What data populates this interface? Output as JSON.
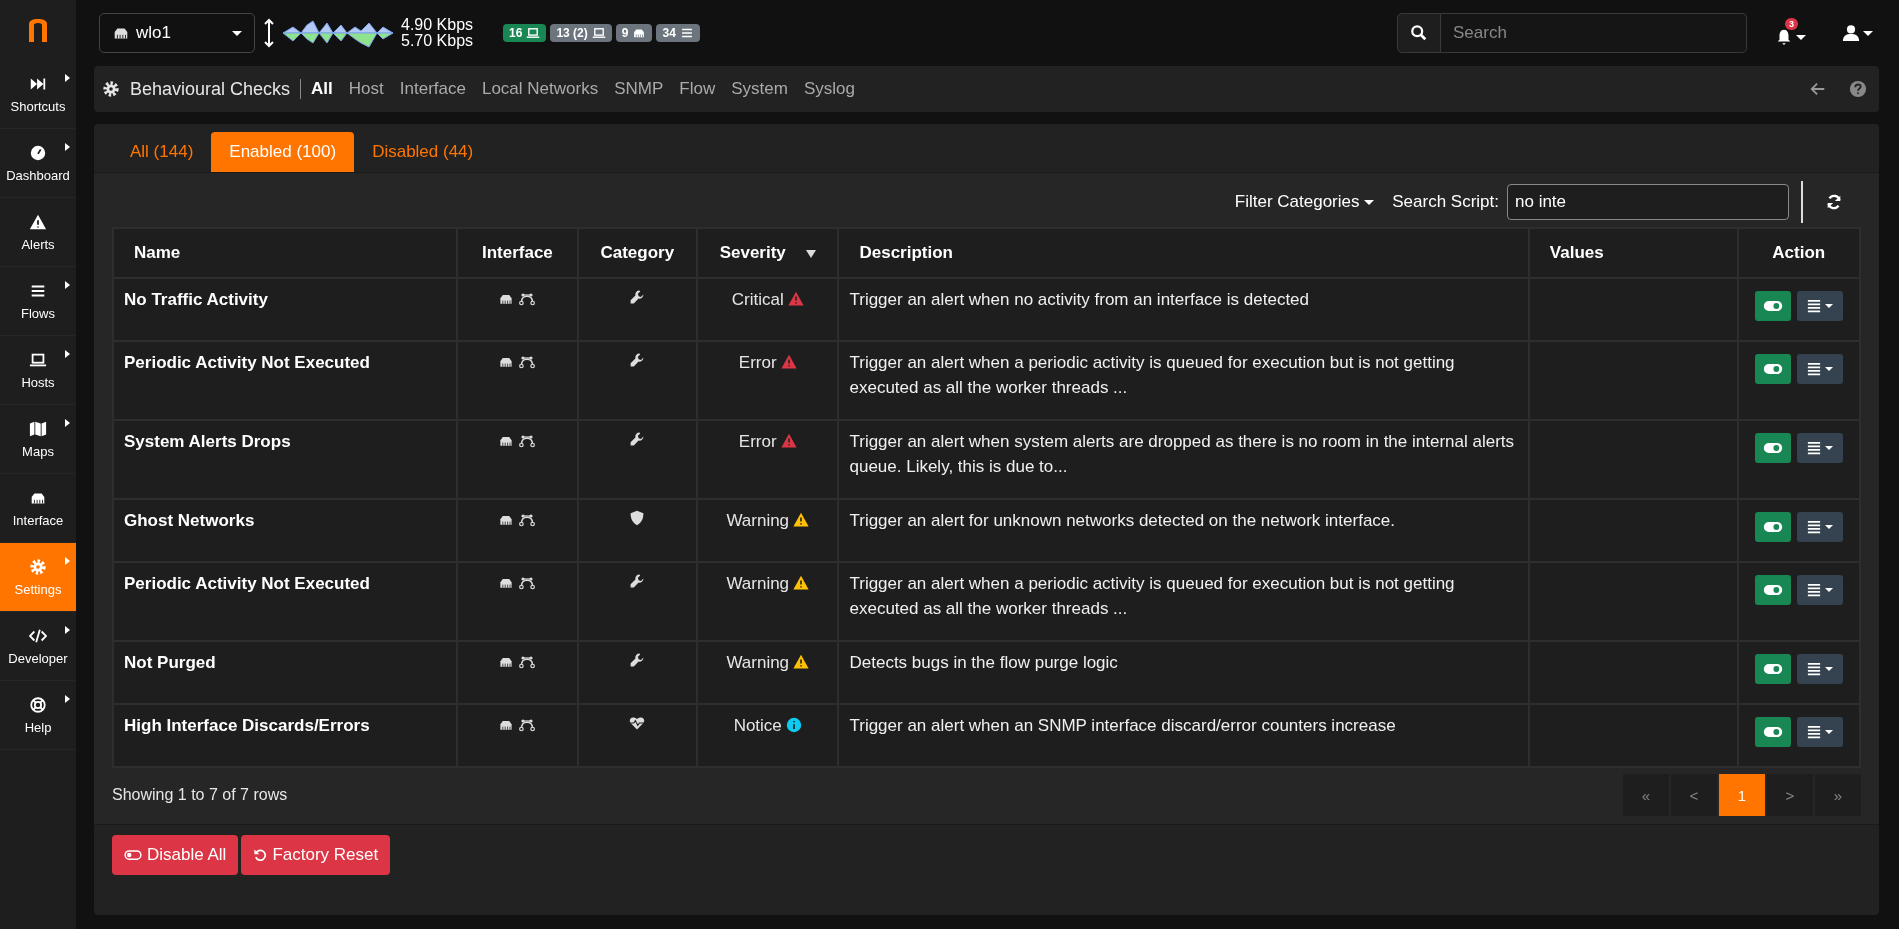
{
  "topbar": {
    "interface": "wlo1",
    "traffic_up": "4.90 Kbps",
    "traffic_down": "5.70 Kbps",
    "badges": [
      {
        "text": "16",
        "kind": "laptop",
        "color": "#198754"
      },
      {
        "text": "13 (2)",
        "kind": "laptop",
        "color": "#6c757d"
      },
      {
        "text": "9",
        "kind": "ethernet",
        "color": "#6c757d"
      },
      {
        "text": "34",
        "kind": "list",
        "color": "#6c757d"
      }
    ],
    "search": {
      "placeholder": "Search"
    },
    "notifications": "3"
  },
  "sidebar": {
    "items": [
      {
        "label": "Shortcuts",
        "kind": "forward",
        "submenu": true,
        "selected": false
      },
      {
        "label": "Dashboard",
        "kind": "gauge",
        "submenu": true,
        "selected": false
      },
      {
        "label": "Alerts",
        "kind": "warning",
        "submenu": false,
        "selected": false
      },
      {
        "label": "Flows",
        "kind": "bars",
        "submenu": true,
        "selected": false
      },
      {
        "label": "Hosts",
        "kind": "laptop",
        "submenu": true,
        "selected": false
      },
      {
        "label": "Maps",
        "kind": "map",
        "submenu": true,
        "selected": false
      },
      {
        "label": "Interface",
        "kind": "ethernet",
        "submenu": false,
        "selected": false
      },
      {
        "label": "Settings",
        "kind": "gear",
        "submenu": true,
        "selected": true
      },
      {
        "label": "Developer",
        "kind": "code",
        "submenu": true,
        "selected": false
      },
      {
        "label": "Help",
        "kind": "lifering",
        "submenu": true,
        "selected": false
      }
    ]
  },
  "header": {
    "title": "Behavioural Checks",
    "links": [
      {
        "label": "All",
        "selected": true
      },
      {
        "label": "Host",
        "selected": false
      },
      {
        "label": "Interface",
        "selected": false
      },
      {
        "label": "Local Networks",
        "selected": false
      },
      {
        "label": "SNMP",
        "selected": false
      },
      {
        "label": "Flow",
        "selected": false
      },
      {
        "label": "System",
        "selected": false
      },
      {
        "label": "Syslog",
        "selected": false
      }
    ]
  },
  "tabs": [
    {
      "label": "All (144)",
      "selected": false
    },
    {
      "label": "Enabled (100)",
      "selected": true
    },
    {
      "label": "Disabled (44)",
      "selected": false
    }
  ],
  "toolbar": {
    "filter": "Filter Categories",
    "search_label": "Search Script:",
    "search_value": "no inte"
  },
  "table": {
    "columns": [
      "Name",
      "Interface",
      "Category",
      "Severity",
      "Description",
      "Values",
      "Action"
    ],
    "rows": [
      {
        "name": "No Traffic Activity",
        "category": {
          "kind": "wrench"
        },
        "severity": {
          "text": "Critical",
          "kind": "critical"
        },
        "description": "Trigger an alert when no activity from an interface is detected",
        "enabled": true
      },
      {
        "name": "Periodic Activity Not Executed",
        "category": {
          "kind": "wrench"
        },
        "severity": {
          "text": "Error",
          "kind": "error"
        },
        "description": "Trigger an alert when a periodic activity is queued for execution but is not getting executed as all the worker threads ...",
        "enabled": true
      },
      {
        "name": "System Alerts Drops",
        "category": {
          "kind": "wrench"
        },
        "severity": {
          "text": "Error",
          "kind": "error"
        },
        "description": "Trigger an alert when system alerts are dropped as there is no room in the internal alerts queue. Likely, this is due to...",
        "enabled": true
      },
      {
        "name": "Ghost Networks",
        "category": {
          "kind": "shield"
        },
        "severity": {
          "text": "Warning",
          "kind": "warning"
        },
        "description": "Trigger an alert for unknown networks detected on the network interface.",
        "enabled": true
      },
      {
        "name": "Periodic Activity Not Executed",
        "category": {
          "kind": "wrench"
        },
        "severity": {
          "text": "Warning",
          "kind": "warning"
        },
        "description": "Trigger an alert when a periodic activity is queued for execution but is not getting executed as all the worker threads ...",
        "enabled": true
      },
      {
        "name": "Not Purged",
        "category": {
          "kind": "wrench"
        },
        "severity": {
          "text": "Warning",
          "kind": "warning"
        },
        "description": "Detects bugs in the flow purge logic",
        "enabled": true
      },
      {
        "name": "High Interface Discards/Errors",
        "category": {
          "kind": "heartbeat"
        },
        "severity": {
          "text": "Notice",
          "kind": "notice"
        },
        "description": "Trigger an alert when an SNMP interface discard/error counters increase",
        "enabled": true
      }
    ]
  },
  "footer": {
    "summary": "Showing 1 to 7 of 7 rows",
    "pages": [
      {
        "label": "«",
        "selected": false
      },
      {
        "label": "<",
        "selected": false
      },
      {
        "label": "1",
        "selected": true
      },
      {
        "label": ">",
        "selected": false
      },
      {
        "label": "»",
        "selected": false
      }
    ]
  },
  "buttons": [
    {
      "label": "Disable All",
      "kind": "toggle"
    },
    {
      "label": "Factory Reset",
      "kind": "undo"
    }
  ]
}
